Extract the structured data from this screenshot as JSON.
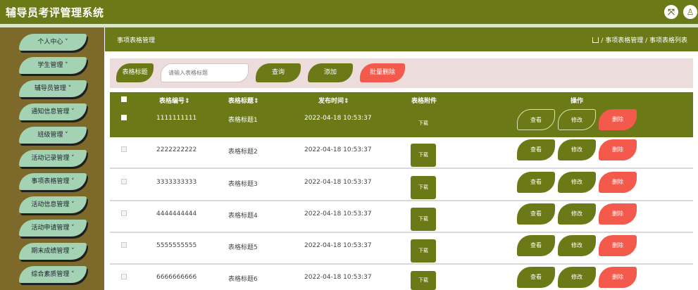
{
  "app": {
    "title": "辅导员考评管理系统"
  },
  "colors": {
    "primary": "#6b7a16",
    "danger": "#f45a4c",
    "nav": "#a4d3b3",
    "sidebar": "#7d6a2a",
    "searchbg": "#eddcdc"
  },
  "sidebar": {
    "items": [
      {
        "label": "个人中心 ˅"
      },
      {
        "label": "学生管理 ˅"
      },
      {
        "label": "辅导员管理 ˅"
      },
      {
        "label": "通知信息管理 ˅"
      },
      {
        "label": "班级管理 ˅"
      },
      {
        "label": "活动记录管理 ˅"
      },
      {
        "label": "事项表格管理 ˅"
      },
      {
        "label": "活动信息管理 ˅"
      },
      {
        "label": "活动申请管理 ˅"
      },
      {
        "label": "期末成绩管理 ˅"
      },
      {
        "label": "综合素质管理 ˅"
      }
    ]
  },
  "header": {
    "page_title": "事项表格管理",
    "breadcrumb": "/ 事项表格管理 / 事项表格列表"
  },
  "search": {
    "label": "表格标题",
    "placeholder": "请输入表格标题",
    "query_label": "查询",
    "add_label": "添加",
    "bulk_delete_label": "批量删除"
  },
  "table": {
    "columns": [
      "表格编号⇕",
      "表格标题⇕",
      "发布时间⇕",
      "表格附件",
      "操作"
    ],
    "download_label": "下载",
    "view_label": "查看",
    "edit_label": "修改",
    "delete_label": "删除",
    "rows": [
      {
        "id": "1111111111",
        "title": "表格标题1",
        "time": "2022-04-18 10:53:37"
      },
      {
        "id": "2222222222",
        "title": "表格标题2",
        "time": "2022-04-18 10:53:37"
      },
      {
        "id": "3333333333",
        "title": "表格标题3",
        "time": "2022-04-18 10:53:37"
      },
      {
        "id": "4444444444",
        "title": "表格标题4",
        "time": "2022-04-18 10:53:37"
      },
      {
        "id": "5555555555",
        "title": "表格标题5",
        "time": "2022-04-18 10:53:37"
      },
      {
        "id": "6666666666",
        "title": "表格标题6",
        "time": "2022-04-18 10:53:37"
      }
    ]
  }
}
